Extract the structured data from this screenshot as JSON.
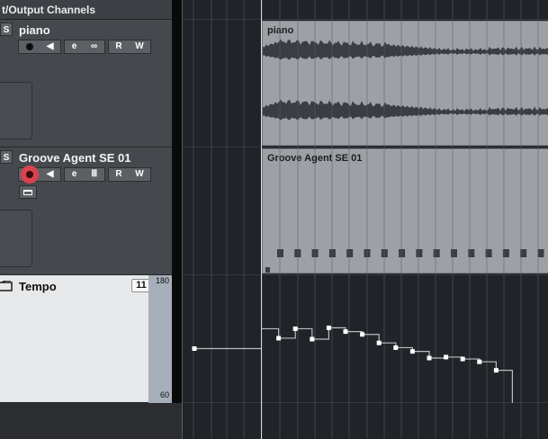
{
  "folder": {
    "title": "t/Output Channels"
  },
  "tracks": [
    {
      "name": "piano",
      "solo": "S",
      "buttons": {
        "monitor": "",
        "edit": "e",
        "link": "∞",
        "read": "R",
        "write": "W"
      },
      "event_label": "piano",
      "armed": false
    },
    {
      "name": "Groove Agent SE 01",
      "solo": "S",
      "buttons": {
        "monitor": "",
        "edit": "e",
        "keys": "Ⅲ",
        "read": "R",
        "write": "W"
      },
      "event_label": "Groove Agent SE 01",
      "armed": true
    }
  ],
  "tempo_track": {
    "name": "Tempo",
    "value_box": "11",
    "range_max": "180",
    "range_min": "60"
  },
  "tempo_points": [
    {
      "seg": "pre",
      "x": 0,
      "v": 110
    },
    {
      "seg": "main",
      "x": 0,
      "v": 131
    },
    {
      "seg": "main",
      "x": 1,
      "v": 121
    },
    {
      "seg": "main",
      "x": 2,
      "v": 131
    },
    {
      "seg": "main",
      "x": 3,
      "v": 120
    },
    {
      "seg": "main",
      "x": 4,
      "v": 132
    },
    {
      "seg": "main",
      "x": 5,
      "v": 128
    },
    {
      "seg": "main",
      "x": 6,
      "v": 125
    },
    {
      "seg": "main",
      "x": 7,
      "v": 116
    },
    {
      "seg": "main",
      "x": 8,
      "v": 111
    },
    {
      "seg": "main",
      "x": 9,
      "v": 107
    },
    {
      "seg": "main",
      "x": 10,
      "v": 100
    },
    {
      "seg": "main",
      "x": 11,
      "v": 101
    },
    {
      "seg": "main",
      "x": 12,
      "v": 99
    },
    {
      "seg": "main",
      "x": 13,
      "v": 96
    },
    {
      "seg": "main",
      "x": 14,
      "v": 87
    }
  ],
  "colors": {
    "panel": "#45484c",
    "panel_tempo": "#e7e8e9",
    "record_armed": "#d9424f",
    "event_fill": "#9da1a6",
    "waveform": "#3a3d41",
    "grid": "#5a6066"
  }
}
